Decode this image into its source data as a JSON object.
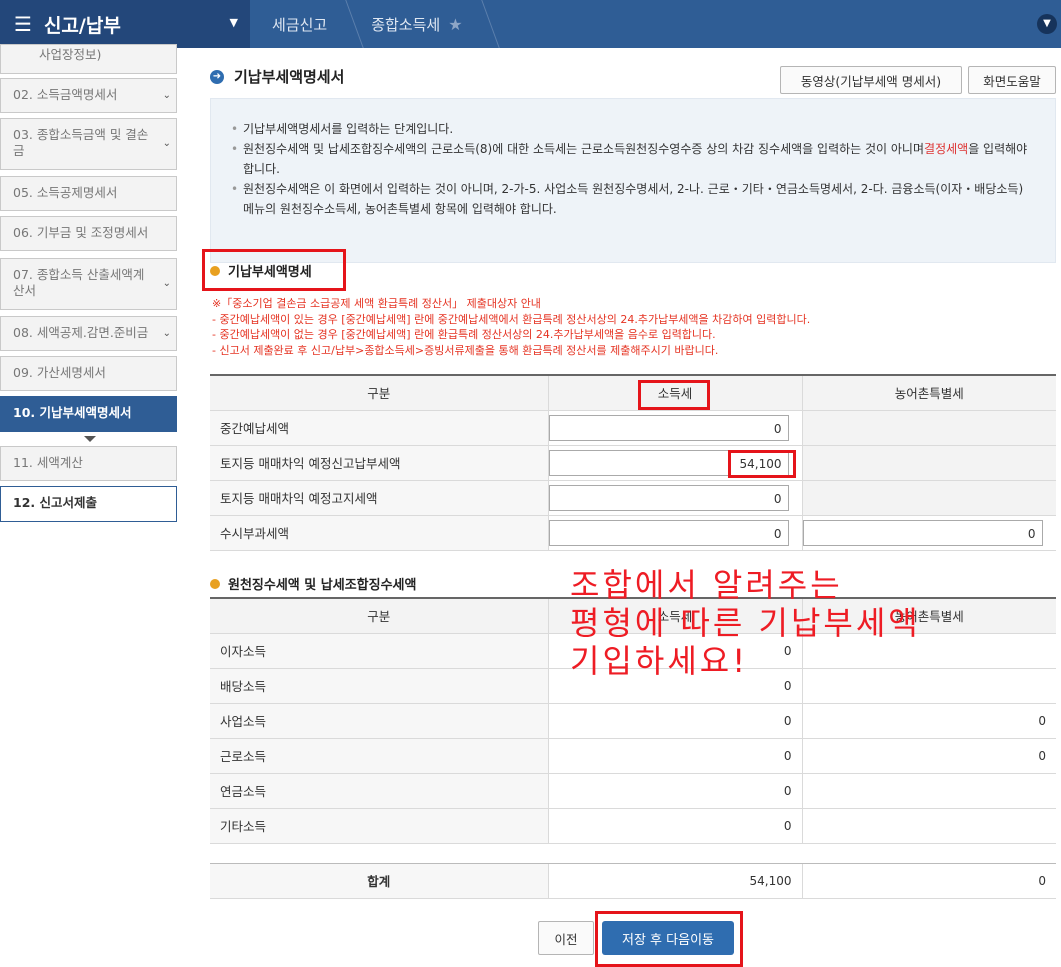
{
  "topbar": {
    "menu_title": "신고/납부",
    "breadcrumbs": [
      "세금신고",
      "종합소득세"
    ]
  },
  "sidebar": {
    "items": [
      {
        "label": "사업장정보)"
      },
      {
        "label": "02. 소득금액명세서"
      },
      {
        "label": "03. 종합소득금액 및 결손금"
      },
      {
        "label": "05. 소득공제명세서"
      },
      {
        "label": "06. 기부금 및 조정명세서"
      },
      {
        "label": "07. 종합소득 산출세액계산서"
      },
      {
        "label": "08. 세액공제.감면.준비금"
      },
      {
        "label": "09. 가산세명세서"
      },
      {
        "label": "10. 기납부세액명세서"
      },
      {
        "label": "11. 세액계산"
      },
      {
        "label": "12. 신고서제출"
      }
    ]
  },
  "page": {
    "title": "기납부세액명세서",
    "video_button": "동영상(기납부세액 명세서)",
    "help_button": "화면도움말"
  },
  "info": {
    "line1": "기납부세액명세서를 입력하는 단계입니다.",
    "line2a": "원천징수세액 및 납세조합징수세액의 근로소득(8)에 대한 소득세는 근로소득원천징수영수증 상의 차감 징수세액을 입력하는 것이 아니며",
    "line2b": "결정세액",
    "line2c": "을 입력해야 합니다.",
    "line3": "원천징수세액은 이 화면에서 입력하는 것이 아니며, 2-가-5. 사업소득 원천징수명세서, 2-나. 근로・기타・연금소득명세서, 2-다. 금융소득(이자・배당소득) 메뉴의 원천징수소득세, 농어촌특별세 항목에 입력해야 합니다."
  },
  "section1": {
    "title": "기납부세액명세",
    "notice": [
      "※「중소기업 결손금 소급공제 세액 환급특례 정산서」 제출대상자 안내",
      "- 중간예납세액이 있는 경우 [중간예납세액] 란에 중간예납세액에서 환급특례 정산서상의 24.추가납부세액을 차감하여 입력합니다.",
      "- 중간예납세액이 없는 경우 [중간예납세액] 란에 환급특례 정산서상의 24.추가납부세액을 음수로 입력합니다.",
      "- 신고서 제출완료 후 신고/납부>종합소득세>증빙서류제출을 통해 환급특례 정산서를 제출해주시기 바랍니다."
    ],
    "headers": [
      "구분",
      "소득세",
      "농어촌특별세"
    ],
    "rows": [
      {
        "label": "중간예납세액",
        "income_tax": "0",
        "rural_tax": ""
      },
      {
        "label": "토지등 매매차익 예정신고납부세액",
        "income_tax": "54,100",
        "rural_tax": ""
      },
      {
        "label": "토지등 매매차익 예정고지세액",
        "income_tax": "0",
        "rural_tax": ""
      },
      {
        "label": "수시부과세액",
        "income_tax": "0",
        "rural_tax": "0"
      }
    ]
  },
  "section2": {
    "title": "원천징수세액 및 납세조합징수세액",
    "headers": [
      "구분",
      "소득세",
      "농어촌특별세"
    ],
    "rows": [
      {
        "label": "이자소득",
        "income_tax": "0",
        "rural_tax": ""
      },
      {
        "label": "배당소득",
        "income_tax": "0",
        "rural_tax": ""
      },
      {
        "label": "사업소득",
        "income_tax": "0",
        "rural_tax": "0"
      },
      {
        "label": "근로소득",
        "income_tax": "0",
        "rural_tax": "0"
      },
      {
        "label": "연금소득",
        "income_tax": "0",
        "rural_tax": ""
      },
      {
        "label": "기타소득",
        "income_tax": "0",
        "rural_tax": ""
      }
    ],
    "total_label": "합계",
    "total_income_tax": "54,100",
    "total_rural_tax": "0"
  },
  "annotation": {
    "line1": "조합에서 알려주는",
    "line2": "평형에 따른 기납부세액",
    "line3": "기입하세요!"
  },
  "footer": {
    "prev_button": "이전",
    "save_button": "저장 후 다음이동"
  }
}
